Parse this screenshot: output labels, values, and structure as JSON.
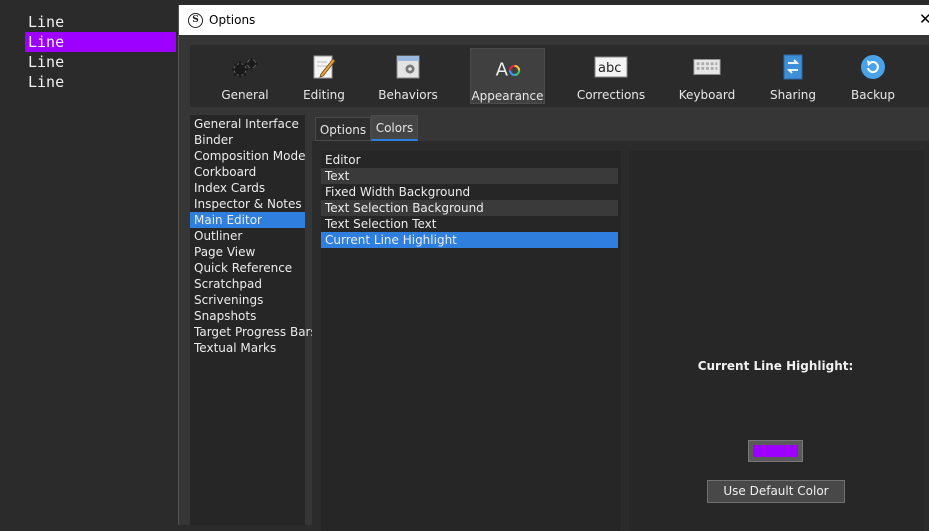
{
  "editor": {
    "lines": [
      "Line",
      "Line",
      "Line",
      "Line"
    ],
    "highlight_color": "#9d00ff"
  },
  "window": {
    "title": "Options",
    "app_icon": "S"
  },
  "toolbar": {
    "items": [
      {
        "label": "General",
        "icon": "gears-icon"
      },
      {
        "label": "Editing",
        "icon": "pencil-page-icon"
      },
      {
        "label": "Behaviors",
        "icon": "gear-window-icon"
      },
      {
        "label": "Appearance",
        "icon": "font-color-icon",
        "selected": true
      },
      {
        "label": "Corrections",
        "icon": "abc-icon"
      },
      {
        "label": "Keyboard",
        "icon": "keyboard-icon"
      },
      {
        "label": "Sharing",
        "icon": "sync-document-icon"
      },
      {
        "label": "Backup",
        "icon": "backup-icon"
      }
    ]
  },
  "nav": {
    "items": [
      "General Interface",
      "Binder",
      "Composition Mode",
      "Corkboard",
      "Index Cards",
      "Inspector & Notes",
      "Main Editor",
      "Outliner",
      "Page View",
      "Quick Reference",
      "Scratchpad",
      "Scrivenings",
      "Snapshots",
      "Target Progress Bars",
      "Textual Marks"
    ],
    "selected": "Main Editor"
  },
  "tabs": {
    "options_label": "Options",
    "colors_label": "Colors",
    "active": "Colors"
  },
  "colors_list": {
    "items": [
      "Editor",
      "Text",
      "Fixed Width Background",
      "Text Selection Background",
      "Text Selection Text",
      "Current Line Highlight"
    ],
    "selected": "Current Line Highlight"
  },
  "color_panel": {
    "label": "Current Line Highlight:",
    "swatch_color": "#9d00ff",
    "default_button": "Use Default Color"
  },
  "accent_color": "#2e7fde"
}
